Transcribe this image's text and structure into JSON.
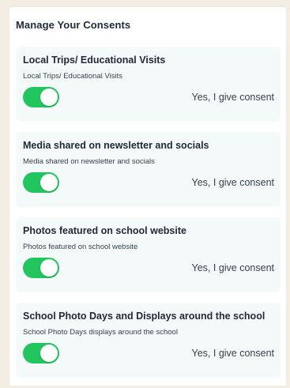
{
  "panel": {
    "title": "Manage Your Consents"
  },
  "colors": {
    "toggle_on": "#22c55e",
    "card_background": "#f4f9f9",
    "page_background": "#f3ede3"
  },
  "consents": [
    {
      "title": "Local Trips/ Educational Visits",
      "description": "Local Trips/ Educational Visits",
      "toggle_on": true,
      "status": "Yes, I give consent"
    },
    {
      "title": "Media shared on newsletter and socials",
      "description": "Media shared on newsletter and socials",
      "toggle_on": true,
      "status": "Yes, I give consent"
    },
    {
      "title": "Photos featured on school website",
      "description": "Photos featured on school website",
      "toggle_on": true,
      "status": "Yes, I give consent"
    },
    {
      "title": "School Photo Days and Displays around the school",
      "description": "School Photo Days displays around the school",
      "toggle_on": true,
      "status": "Yes, I give consent"
    }
  ]
}
